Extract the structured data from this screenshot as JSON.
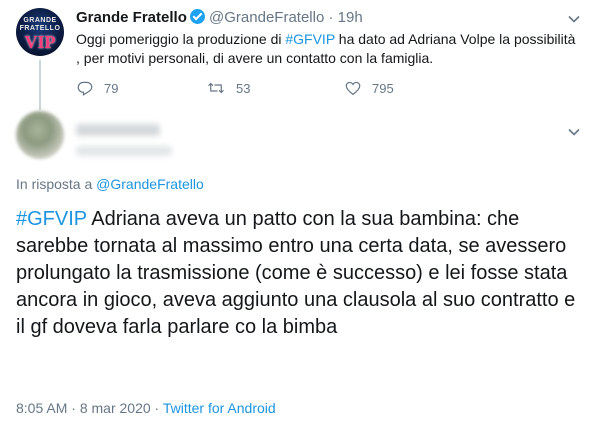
{
  "tweet1": {
    "display_name": "Grande Fratello",
    "handle": "@GrandeFratello",
    "separator": "·",
    "time": "19h",
    "text_before": "Oggi pomeriggio la produzione di ",
    "hashtag": "#GFVIP",
    "text_after": " ha dato ad Adriana Volpe  la possibilità , per motivi personali, di avere un contatto con la famiglia.",
    "reply_count": "79",
    "retweet_count": "53",
    "like_count": "795",
    "avatar_logo_top": "GRANDE",
    "avatar_logo_mid": "FRATELLO",
    "avatar_logo_vip": "VIP"
  },
  "tweet2": {
    "reply_prefix": "In risposta a ",
    "reply_to": "@GrandeFratello",
    "hashtag": "#GFVIP",
    "text": " Adriana aveva un patto con la sua bambina: che sarebbe tornata al massimo entro una certa data, se avessero prolungato la trasmissione (come è successo) e lei fosse stata ancora in gioco, aveva aggiunto una clausola al suo contratto e il gf doveva farla parlare co la bimba",
    "time": "8:05 AM",
    "date": "8 mar 2020",
    "separator": "·",
    "source": "Twitter for Android"
  },
  "colors": {
    "accent": "#1da1f2",
    "link": "#1b95e0",
    "text": "#14171a",
    "muted": "#657786",
    "line": "#ccd6dd"
  },
  "icons": [
    "reply-icon",
    "retweet-icon",
    "like-icon",
    "chevron-down-icon",
    "verified-icon"
  ]
}
